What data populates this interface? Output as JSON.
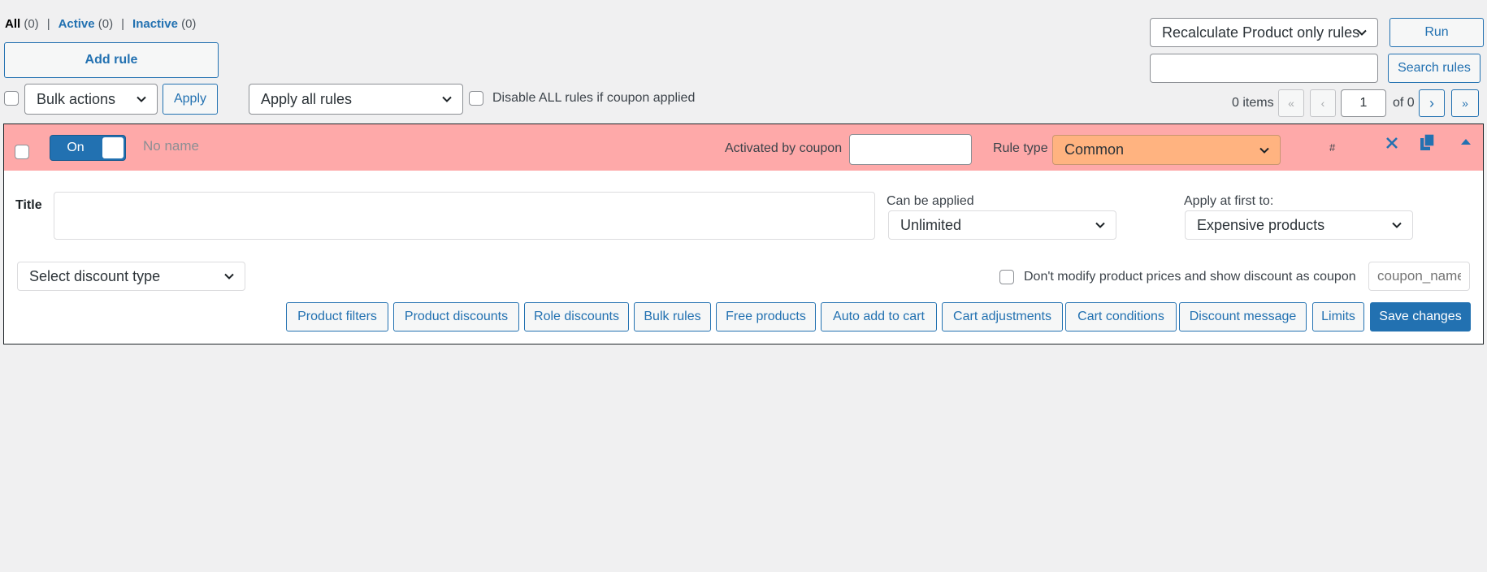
{
  "filters": {
    "all": {
      "label": "All",
      "count": "(0)"
    },
    "active": {
      "label": "Active",
      "count": "(0)"
    },
    "inactive": {
      "label": "Inactive",
      "count": "(0)"
    },
    "separator": "|"
  },
  "toolbar": {
    "add_rule": "Add rule",
    "bulk_actions": "Bulk actions",
    "apply": "Apply",
    "apply_mode": "Apply all rules",
    "disable_coupon_label": "Disable ALL rules if coupon applied",
    "recalculate": "Recalculate Product only rules",
    "run": "Run",
    "search_value": "",
    "search_button": "Search rules"
  },
  "pagination": {
    "items": "0 items",
    "first": "«",
    "prev": "‹",
    "page": "1",
    "of": "of 0",
    "next": "›",
    "last": "»"
  },
  "rule": {
    "toggle_label": "On",
    "name_placeholder": "No name",
    "coupon_label": "Activated by coupon",
    "coupon_value": "",
    "rule_type_label": "Rule type",
    "rule_type_value": "Common",
    "hash": "#",
    "title_label": "Title",
    "title_value": "",
    "can_be_applied_label": "Can be applied",
    "can_be_applied_value": "Unlimited",
    "apply_first_label": "Apply at first to:",
    "apply_first_value": "Expensive products",
    "discount_type": "Select discount type",
    "dont_modify_label": "Don't modify product prices and show discount as coupon",
    "coupon_name_placeholder": "coupon_name",
    "buttons": {
      "product_filters": "Product filters",
      "product_discounts": "Product discounts",
      "role_discounts": "Role discounts",
      "bulk_rules": "Bulk rules",
      "free_products": "Free products",
      "auto_add": "Auto add to cart",
      "cart_adjustments": "Cart adjustments",
      "cart_conditions": "Cart conditions",
      "discount_message": "Discount message",
      "limits": "Limits",
      "save": "Save changes"
    }
  },
  "colors": {
    "accent": "#2271b1",
    "rule_header_bg": "#fea9a9",
    "rule_type_bg": "#ffb380"
  },
  "icons": {
    "remove": "close-icon",
    "duplicate": "copy-icon",
    "collapse": "caret-up-icon"
  }
}
